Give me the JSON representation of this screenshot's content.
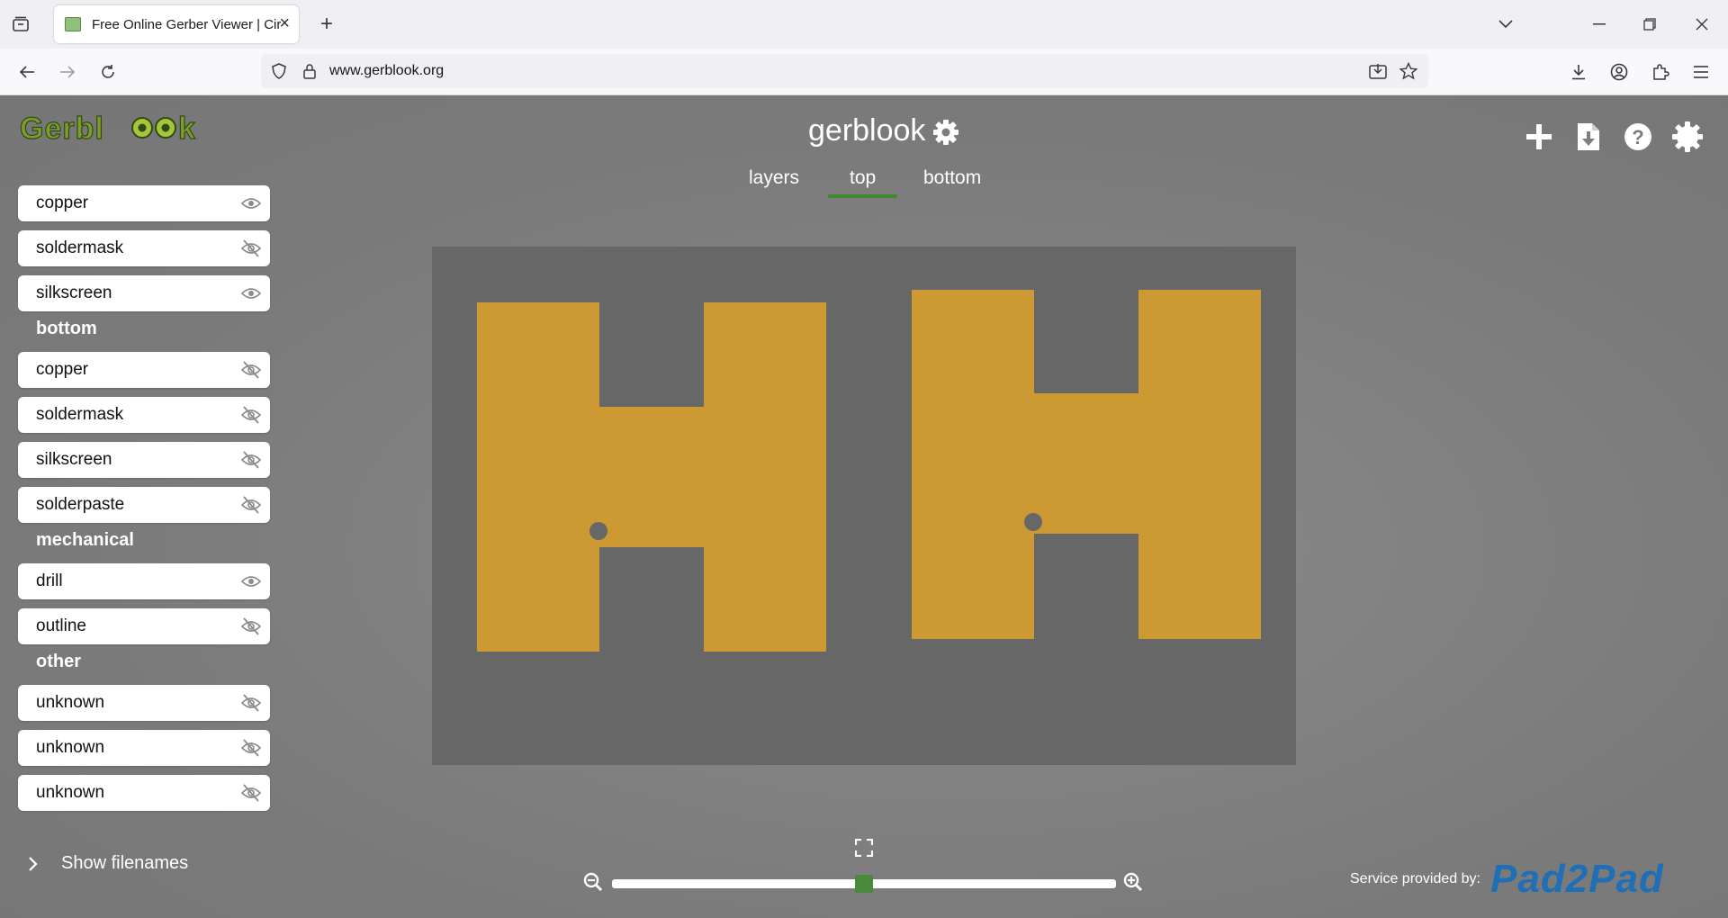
{
  "browser": {
    "tab_title": "Free Online Gerber Viewer | Circ",
    "url": "www.gerblook.org"
  },
  "app": {
    "logo_text": "Gerblook",
    "title": "gerblook",
    "view_tabs": [
      {
        "label": "layers"
      },
      {
        "label": "top",
        "active": true
      },
      {
        "label": "bottom"
      }
    ]
  },
  "sidebar": {
    "top_layers": [
      {
        "label": "copper",
        "visible": true
      },
      {
        "label": "soldermask",
        "visible": false
      },
      {
        "label": "silkscreen",
        "visible": true
      }
    ],
    "bottom_heading": "bottom",
    "bottom_layers": [
      {
        "label": "copper",
        "visible": false
      },
      {
        "label": "soldermask",
        "visible": false
      },
      {
        "label": "silkscreen",
        "visible": false
      },
      {
        "label": "solderpaste",
        "visible": false
      }
    ],
    "mechanical_heading": "mechanical",
    "mechanical_layers": [
      {
        "label": "drill",
        "visible": true
      },
      {
        "label": "outline",
        "visible": false
      }
    ],
    "other_heading": "other",
    "other_layers": [
      {
        "label": "unknown",
        "visible": false
      },
      {
        "label": "unknown",
        "visible": false
      },
      {
        "label": "unknown",
        "visible": false
      }
    ],
    "show_filenames": "Show filenames"
  },
  "zoom": {
    "level": 0.5
  },
  "footer": {
    "service_label": "Service provided by:",
    "brand": "Pad2Pad"
  },
  "colors": {
    "copper": "#cc9933",
    "board": "#676767",
    "accent": "#3f8a2a"
  }
}
